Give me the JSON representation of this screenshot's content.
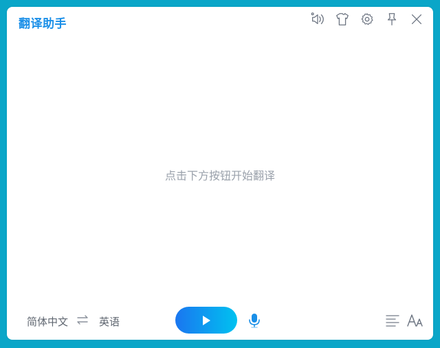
{
  "app": {
    "title": "翻译助手"
  },
  "toolbar": {
    "icons": [
      "sound-settings-icon",
      "shirt-icon",
      "gear-icon",
      "pin-icon",
      "close-icon"
    ]
  },
  "main": {
    "placeholder": "点击下方按钮开始翻译"
  },
  "bottom": {
    "source_language": "简体中文",
    "target_language": "英语",
    "icons": [
      "swap-icon",
      "play-icon",
      "microphone-icon",
      "align-left-icon",
      "font-size-icon"
    ]
  },
  "colors": {
    "background": "#0aa6c8",
    "title": "#1a8fe8",
    "play_gradient_start": "#1a76f0",
    "play_gradient_end": "#00c2f0",
    "mic": "#1a8fe8"
  }
}
